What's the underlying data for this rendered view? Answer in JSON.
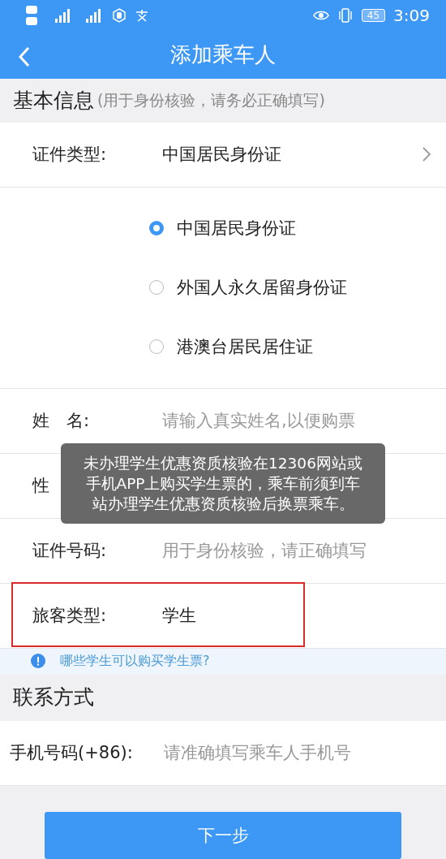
{
  "status_bar": {
    "battery": "45",
    "time": "3:09"
  },
  "header": {
    "title": "添加乘车人"
  },
  "basic_section": {
    "title": "基本信息",
    "note": "(用于身份核验，请务必正确填写)"
  },
  "id_type": {
    "label": "证件类型:",
    "value": "中国居民身份证"
  },
  "id_options": [
    {
      "label": "中国居民身份证",
      "selected": true
    },
    {
      "label": "外国人永久居留身份证",
      "selected": false
    },
    {
      "label": "港澳台居民居住证",
      "selected": false
    }
  ],
  "fields": [
    {
      "label": "姓　名:",
      "placeholder": "请输入真实姓名,以便购票"
    },
    {
      "label": "性"
    },
    {
      "label": "证件号码:",
      "placeholder": "用于身份核验，请正确填写"
    },
    {
      "label": "旅客类型:",
      "value": "学生",
      "highlighted": true
    }
  ],
  "info_link": "哪些学生可以购买学生票?",
  "contact_section": {
    "title": "联系方式"
  },
  "phone": {
    "label": "手机号码(+86):",
    "placeholder": "请准确填写乘车人手机号"
  },
  "next_button": "下一步",
  "toast": "未办理学生优惠资质核验在12306网站或手机APP上购买学生票的，乘车前须到车站办理学生优惠资质核验后换票乘车。"
}
